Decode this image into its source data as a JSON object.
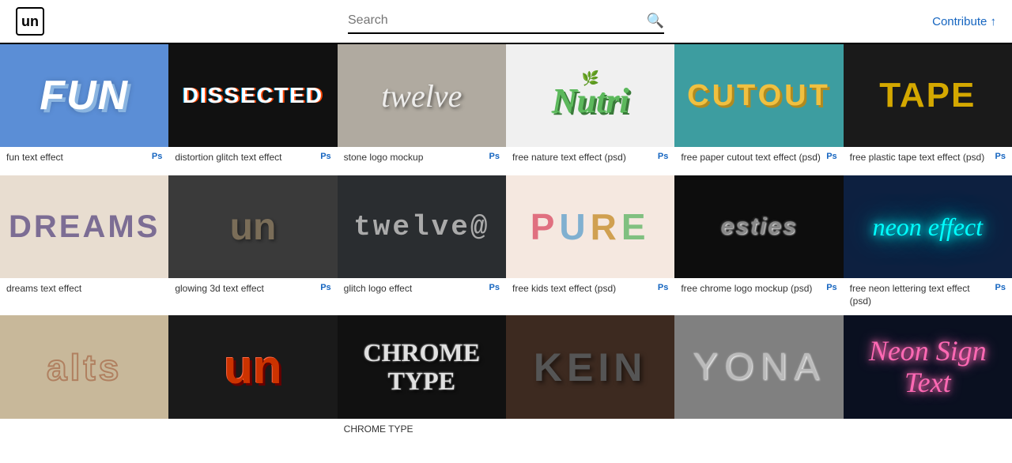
{
  "header": {
    "logo_text": "un",
    "search_placeholder": "Search",
    "contribute_label": "Contribute ↑"
  },
  "cards": [
    {
      "id": "fun-text-effect",
      "title": "fun text effect",
      "has_ps": true,
      "bg": "bg-blue",
      "display": "FUN",
      "style": "fun-text"
    },
    {
      "id": "distortion-glitch-text-effect",
      "title": "distortion glitch text effect",
      "has_ps": true,
      "bg": "bg-black",
      "display": "DISSECTED",
      "style": "dissected-text"
    },
    {
      "id": "stone-logo-mockup",
      "title": "stone logo mockup",
      "has_ps": true,
      "bg": "bg-stone",
      "display": "twelve",
      "style": "twelve-stone-text"
    },
    {
      "id": "free-nature-text-effect",
      "title": "free nature text effect (psd)",
      "has_ps": true,
      "bg": "bg-nature",
      "display": "Nutri",
      "style": "nutri-text"
    },
    {
      "id": "free-paper-cutout-text-effect",
      "title": "free paper cutout text effect (psd)",
      "has_ps": true,
      "bg": "bg-teal",
      "display": "CUTOUT",
      "style": "cutout-text"
    },
    {
      "id": "free-plastic-tape-text-effect",
      "title": "free plastic tape text effect (psd)",
      "has_ps": true,
      "bg": "bg-dark",
      "display": "TAPE",
      "style": "tape-text"
    },
    {
      "id": "dreams-text-effect",
      "title": "dreams text effect",
      "has_ps": false,
      "bg": "bg-cream",
      "display": "DREAMS",
      "style": "dreams-text"
    },
    {
      "id": "glowing-3d-text-effect",
      "title": "glowing 3d text effect",
      "has_ps": true,
      "bg": "bg-charcoal",
      "display": "un",
      "style": "glowing3d-text"
    },
    {
      "id": "glitch-logo-effect",
      "title": "glitch logo effect",
      "has_ps": true,
      "bg": "bg-gunmetal",
      "display": "twelve@",
      "style": "glitch-text"
    },
    {
      "id": "free-kids-text-effect",
      "title": "free kids text effect (psd)",
      "has_ps": true,
      "bg": "bg-pink",
      "display": "PURE",
      "style": "pure-text"
    },
    {
      "id": "free-chrome-logo-mockup",
      "title": "free chrome logo mockup (psd)",
      "has_ps": true,
      "bg": "bg-blackchrome",
      "display": "esties",
      "style": "chrome-logo-text"
    },
    {
      "id": "free-neon-lettering-text-effect",
      "title": "free neon lettering text effect (psd)",
      "has_ps": true,
      "bg": "bg-darkblue",
      "display": "neon effect",
      "style": "neon-text"
    },
    {
      "id": "alts-logo",
      "title": "",
      "has_ps": false,
      "bg": "bg-sand",
      "display": "alts",
      "style": "alts-text"
    },
    {
      "id": "dark-3d-logo",
      "title": "",
      "has_ps": false,
      "bg": "bg-dark",
      "display": "un",
      "style": "dark3d-text"
    },
    {
      "id": "chrome-type",
      "title": "CHROME TYPE",
      "has_ps": false,
      "bg": "bg-black",
      "display": "CHROME TYPE",
      "style": "chrome-type-text"
    },
    {
      "id": "kein-text",
      "title": "",
      "has_ps": false,
      "bg": "bg-brownstone",
      "display": "KEIN",
      "style": "kein-text"
    },
    {
      "id": "yona-text",
      "title": "",
      "has_ps": false,
      "bg": "bg-concrete",
      "display": "YONA",
      "style": "yona-text"
    },
    {
      "id": "neon-sign-text",
      "title": "",
      "has_ps": false,
      "bg": "bg-neondark",
      "display": "Neon Sign Text",
      "style": "neon-sign-text"
    }
  ],
  "ps_badge": "Ps"
}
